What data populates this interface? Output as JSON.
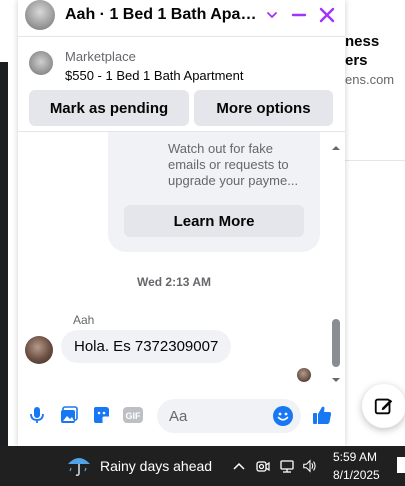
{
  "background": {
    "right_texts": [
      "ness",
      "ers",
      "ens.com"
    ]
  },
  "chat": {
    "title": "Aah · 1 Bed 1 Bath Apartm...",
    "listing": {
      "source": "Marketplace",
      "title": "$550 - 1 Bed 1 Bath Apartment",
      "mark_pending_label": "Mark as pending",
      "more_options_label": "More options"
    },
    "info_card": {
      "text": "Watch out for fake emails or requests to upgrade your payme...",
      "learn_more_label": "Learn More"
    },
    "timestamp": "Wed 2:13 AM",
    "message": {
      "sender": "Aah",
      "text": "Hola. Es 7372309007"
    },
    "composer": {
      "placeholder": "Aa"
    }
  },
  "taskbar": {
    "weather_text": "Rainy days ahead",
    "time": "5:59 AM",
    "date": "8/1/2025"
  },
  "colors": {
    "accent": "#1877f2",
    "header_icons": "#a033ff",
    "taskbar": "#202020"
  }
}
